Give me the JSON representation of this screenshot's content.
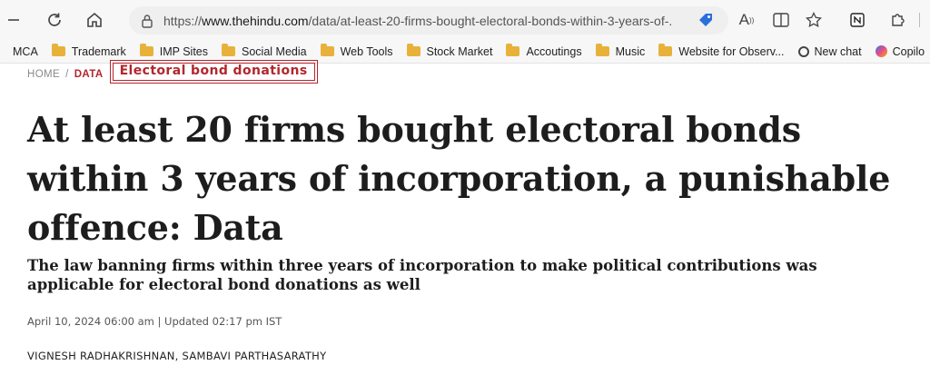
{
  "browser": {
    "url_prefix": "https://",
    "url_domain": "www.thehindu.com",
    "url_path": "/data/at-least-20-firms-bought-electoral-bonds-within-3-years-of-...",
    "bookmarks": [
      {
        "label": "MCA",
        "icon": "folder-icon"
      },
      {
        "label": "Trademark",
        "icon": "folder-icon"
      },
      {
        "label": "IMP Sites",
        "icon": "folder-icon"
      },
      {
        "label": "Social Media",
        "icon": "folder-icon"
      },
      {
        "label": "Web Tools",
        "icon": "folder-icon"
      },
      {
        "label": "Stock Market",
        "icon": "folder-icon"
      },
      {
        "label": "Accoutings",
        "icon": "folder-icon"
      },
      {
        "label": "Music",
        "icon": "folder-icon"
      },
      {
        "label": "Website for Observ...",
        "icon": "folder-icon"
      },
      {
        "label": "New chat",
        "icon": "openai-icon"
      },
      {
        "label": "Copilo",
        "icon": "copilot-icon"
      }
    ],
    "reader_glyph": "A"
  },
  "article": {
    "breadcrumb": {
      "home": "HOME",
      "sep": "/",
      "section": "DATA",
      "tag": "Electoral bond donations"
    },
    "headline": "At least 20 firms bought electoral bonds within 3 years of incorporation, a punishable offence: Data",
    "subhead": "The law banning firms within three years of incorporation to make political contributions was applicable for electoral bond donations as well",
    "dateline": "April 10, 2024 06:00 am | Updated 02:17 pm IST",
    "authors": "VIGNESH RADHAKRISHNAN,  SAMBAVI PARTHASARATHY"
  },
  "colors": {
    "accent": "#b3262d",
    "folder": "#e8b23a"
  }
}
